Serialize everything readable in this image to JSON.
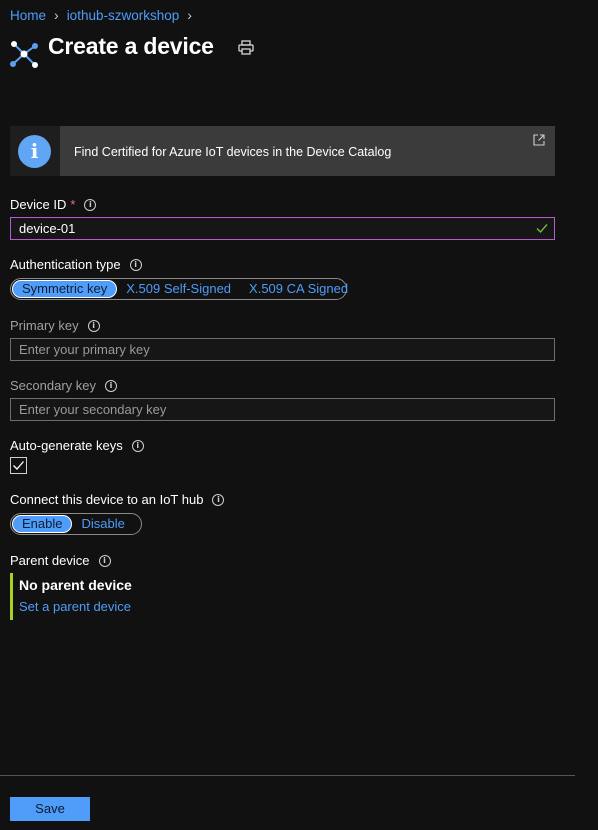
{
  "breadcrumb": {
    "home": "Home",
    "hub": "iothub-szworkshop",
    "separator": ">"
  },
  "header": {
    "title": "Create a device"
  },
  "banner": {
    "text": "Find Certified for Azure IoT devices in the Device Catalog",
    "icon": "info-icon"
  },
  "device_id": {
    "label": "Device ID",
    "required_mark": "*",
    "value": "device-01"
  },
  "auth_type": {
    "label": "Authentication type",
    "options": [
      "Symmetric key",
      "X.509 Self-Signed",
      "X.509 CA Signed"
    ],
    "selected": "Symmetric key"
  },
  "primary_key": {
    "label": "Primary key",
    "placeholder": "Enter your primary key"
  },
  "secondary_key": {
    "label": "Secondary key",
    "placeholder": "Enter your secondary key"
  },
  "auto_generate": {
    "label": "Auto-generate keys",
    "checked": true
  },
  "connect_hub": {
    "label": "Connect this device to an IoT hub",
    "options": [
      "Enable",
      "Disable"
    ],
    "selected": "Enable"
  },
  "parent_device": {
    "label": "Parent device",
    "value": "No parent device",
    "link": "Set a parent device"
  },
  "footer": {
    "save_label": "Save"
  },
  "colors": {
    "background": "#111111",
    "accent": "#4f9cf9",
    "focus_border": "#b65cd0",
    "required": "#f1707b",
    "parent_bar": "#a5d126"
  }
}
